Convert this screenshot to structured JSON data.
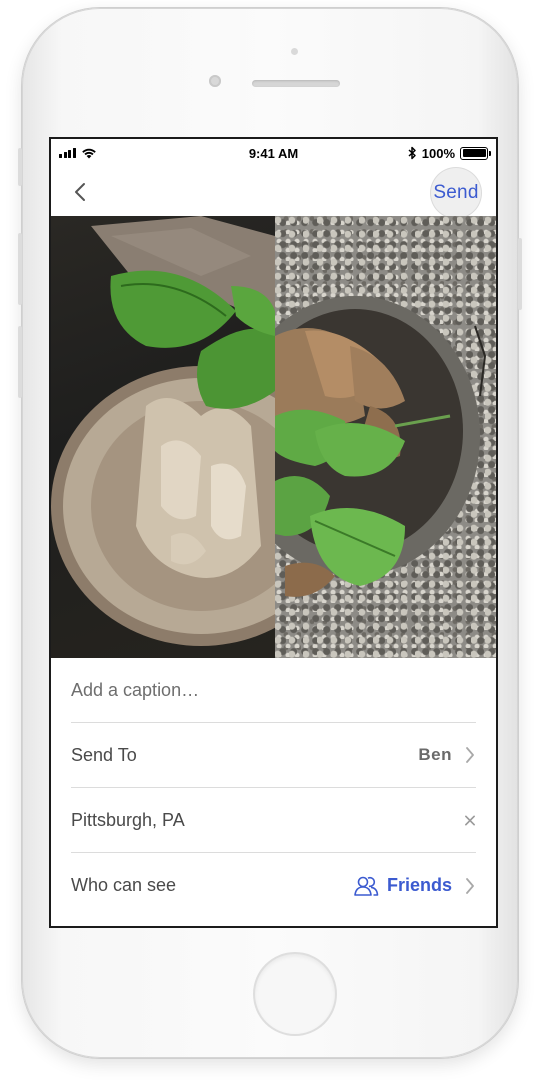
{
  "status_bar": {
    "time": "9:41 AM",
    "battery_percent": "100%",
    "battery_level": 1.0
  },
  "nav": {
    "back_icon": "chevron-left-icon",
    "send_label": "Send"
  },
  "form": {
    "caption_placeholder": "Add a caption…",
    "send_to_label": "Send To",
    "send_to_value": "Ben",
    "location_value": "Pittsburgh, PA",
    "visibility_label": "Who can see",
    "visibility_value": "Friends"
  },
  "colors": {
    "accent": "#3c5bd0",
    "divider": "#dcdcdc",
    "text": "#4a4a4a"
  }
}
